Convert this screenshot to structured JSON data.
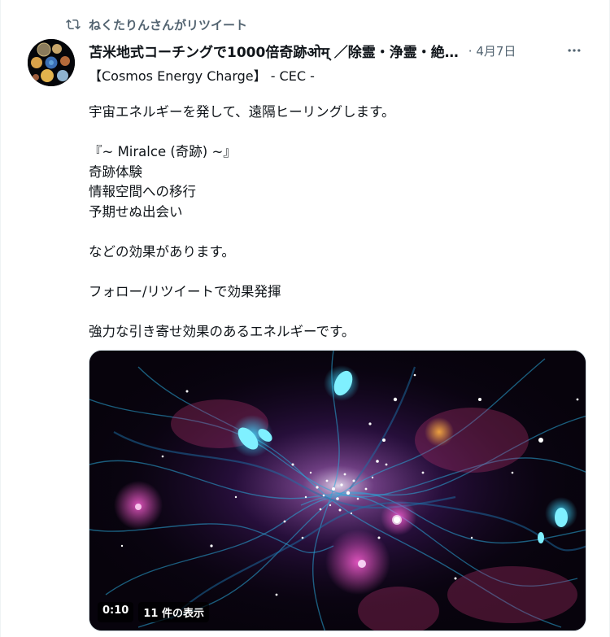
{
  "retweet": {
    "icon": "retweet-icon",
    "text": "ねくたりんさんがリツイート"
  },
  "author": {
    "display_name": "苫米地式コーチングで1000倍奇跡ओम् ／除霊・浄霊・絶…",
    "separator_date": "· 4月7日",
    "handle_line": "【Cosmos Energy Charge】 -  CEC  -"
  },
  "more_icon": "more-horizontal-icon",
  "body": {
    "line1": "宇宙エネルギーを発して、遠隔ヒーリングします。",
    "line2": "『~ Miralce (奇跡) ~』",
    "line3": "奇跡体験",
    "line4": "情報空間への移行",
    "line5": "予期せぬ出会い",
    "line6": "などの効果があります。",
    "line7": "フォロー/リツイートで効果発揮",
    "line8": "強力な引き寄せ効果のあるエネルギーです。"
  },
  "video": {
    "duration": "0:10",
    "views": "11 件の表示"
  },
  "colors": {
    "secondary_text": "#536471",
    "primary_text": "#0f1419",
    "border": "#cfd9de"
  }
}
